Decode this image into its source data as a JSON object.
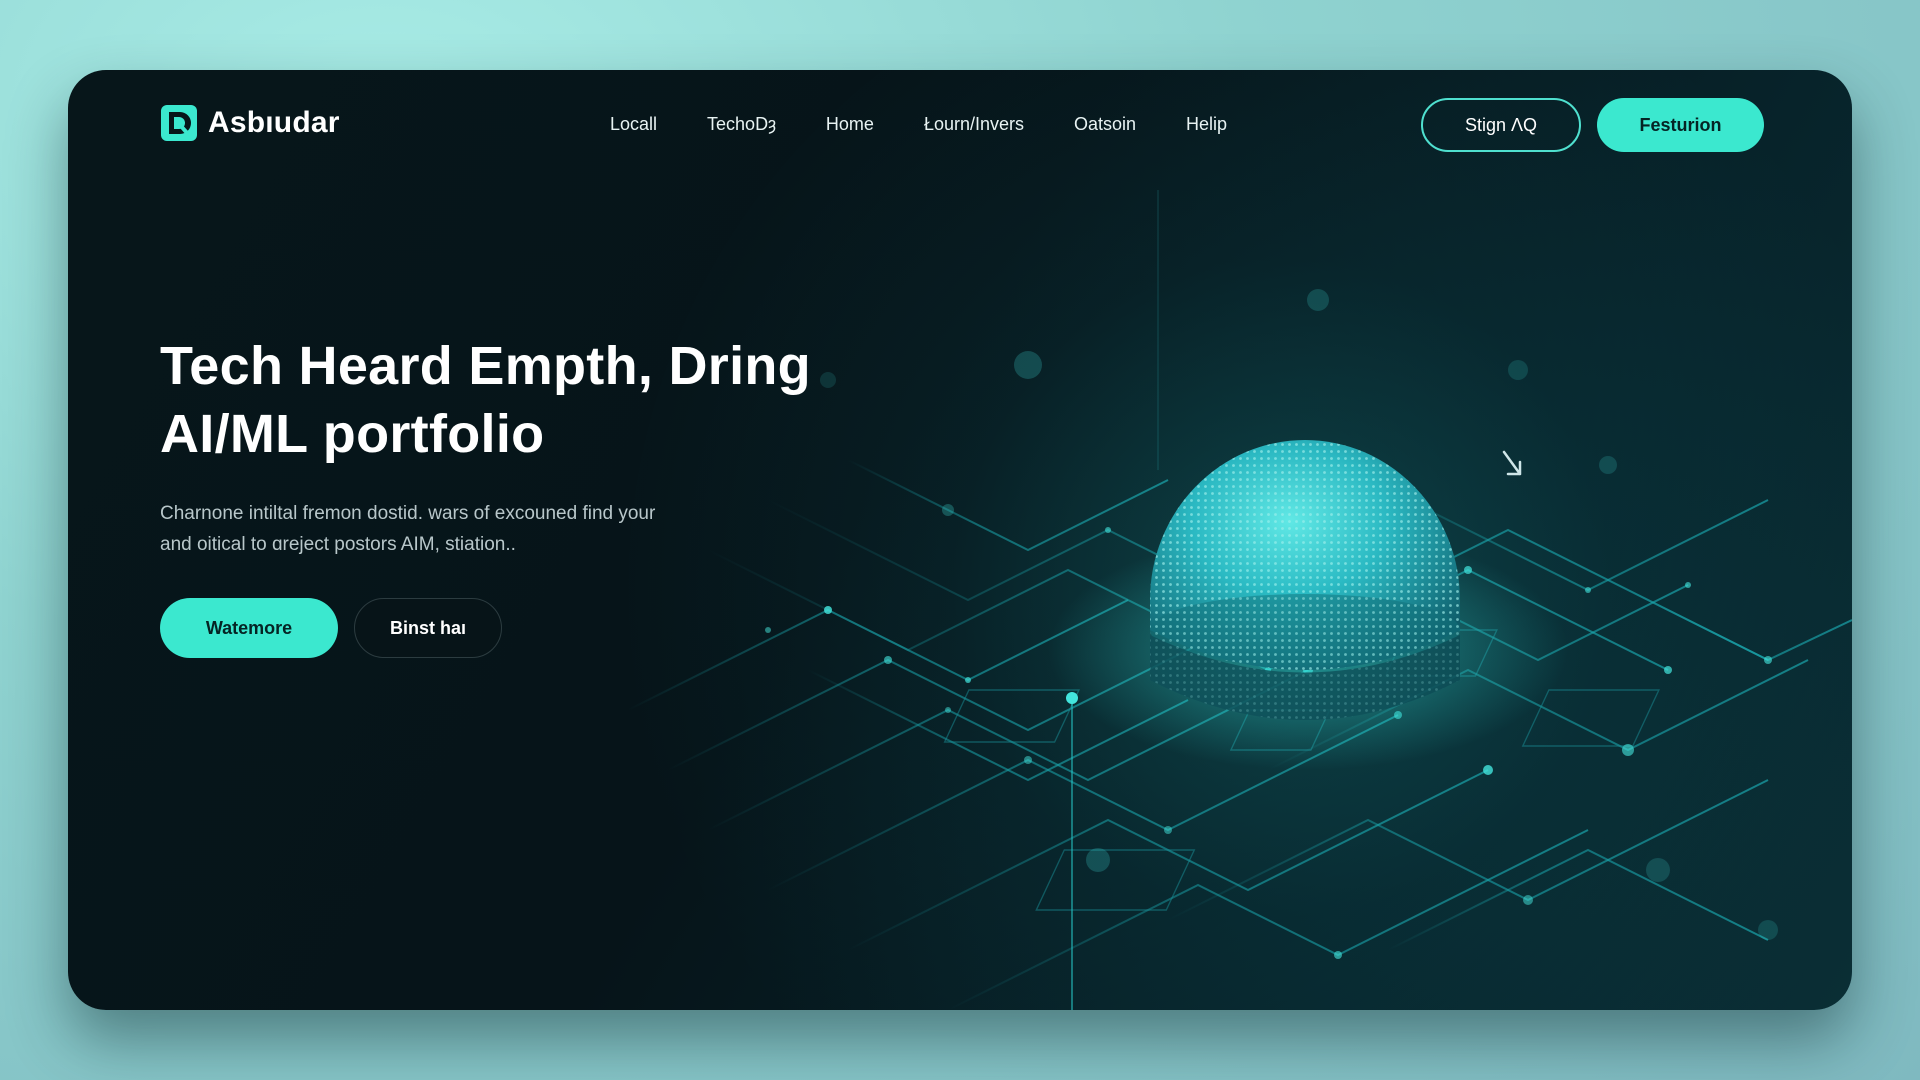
{
  "brand": {
    "name": "Asbıudar"
  },
  "nav": {
    "items": [
      "Locall",
      "TechoDȝ",
      "Home",
      "Łourn/Invers",
      "Oatsoin",
      "Helip"
    ],
    "sign_in_label": "Stign ΛQ",
    "feature_label": "Festurion"
  },
  "hero": {
    "title_line1": "Tech Heard Empth, Dring",
    "title_line2": "AI/ML  portfolio",
    "desc_line1": "Charnone intiltal fremon dostid. wars of excouned find your",
    "desc_line2": "and oitical to ɑreject postors AIM, stiation..",
    "primary_label": "Watemore",
    "secondary_label": "Binst haı"
  },
  "colors": {
    "accent": "#3be8cf",
    "panel": "#07161a",
    "outer_bg": "#8fd3d0"
  },
  "icons": {
    "logo": "brand-logo-icon",
    "cursor": "cursor-arrow-icon"
  }
}
